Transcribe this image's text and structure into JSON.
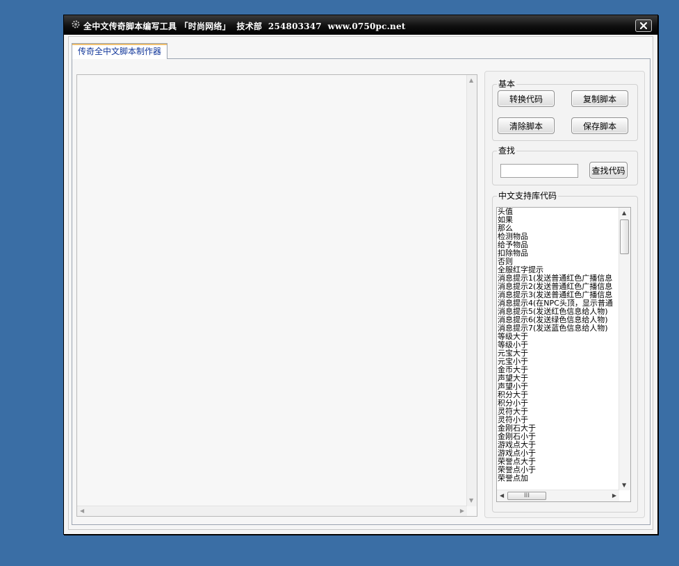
{
  "window": {
    "title": "全中文传奇脚本编写工具 「时尚网络」  技术部  254803347  www.0750pc.net",
    "app_icon": "gear-app-icon",
    "close_icon": "close-icon"
  },
  "tabs": [
    {
      "label": "传奇全中文脚本制作器",
      "active": true
    }
  ],
  "editor": {
    "content": ""
  },
  "basic_group": {
    "label": "基本",
    "convert_button": "转换代码",
    "copy_button": "复制脚本",
    "clear_button": "清除脚本",
    "save_button": "保存脚本"
  },
  "search_group": {
    "label": "查找",
    "input_value": "",
    "search_button": "查找代码"
  },
  "library_group": {
    "label": "中文支持库代码",
    "items": [
      "头值",
      "如果",
      "那么",
      "检测物品",
      "给予物品",
      "扣除物品",
      "否则",
      "全服红字提示",
      "消息提示1(发送普通红色广播信息",
      "消息提示2(发送普通红色广播信息",
      "消息提示3(发送普通红色广播信息",
      "消息提示4(在NPC头顶，显示普通",
      "消息提示5(发送红色信息给人物)",
      "消息提示6(发送绿色信息给人物)",
      "消息提示7(发送蓝色信息给人物)",
      "等级大于",
      "等级小于",
      "元宝大于",
      "元宝小于",
      "金币大于",
      "声望大于",
      "声望小于",
      "积分大于",
      "积分小于",
      "灵符大于",
      "灵符小于",
      "金刚石大于",
      "金刚石小于",
      "游戏点大于",
      "游戏点小于",
      "荣誉点大于",
      "荣誉点小于",
      "荣誉点加"
    ],
    "hscroll_thumb_text": "III"
  },
  "colors": {
    "desktop": "#3a6ea5",
    "titlebar": "#000000",
    "tab_text": "#12379a"
  }
}
